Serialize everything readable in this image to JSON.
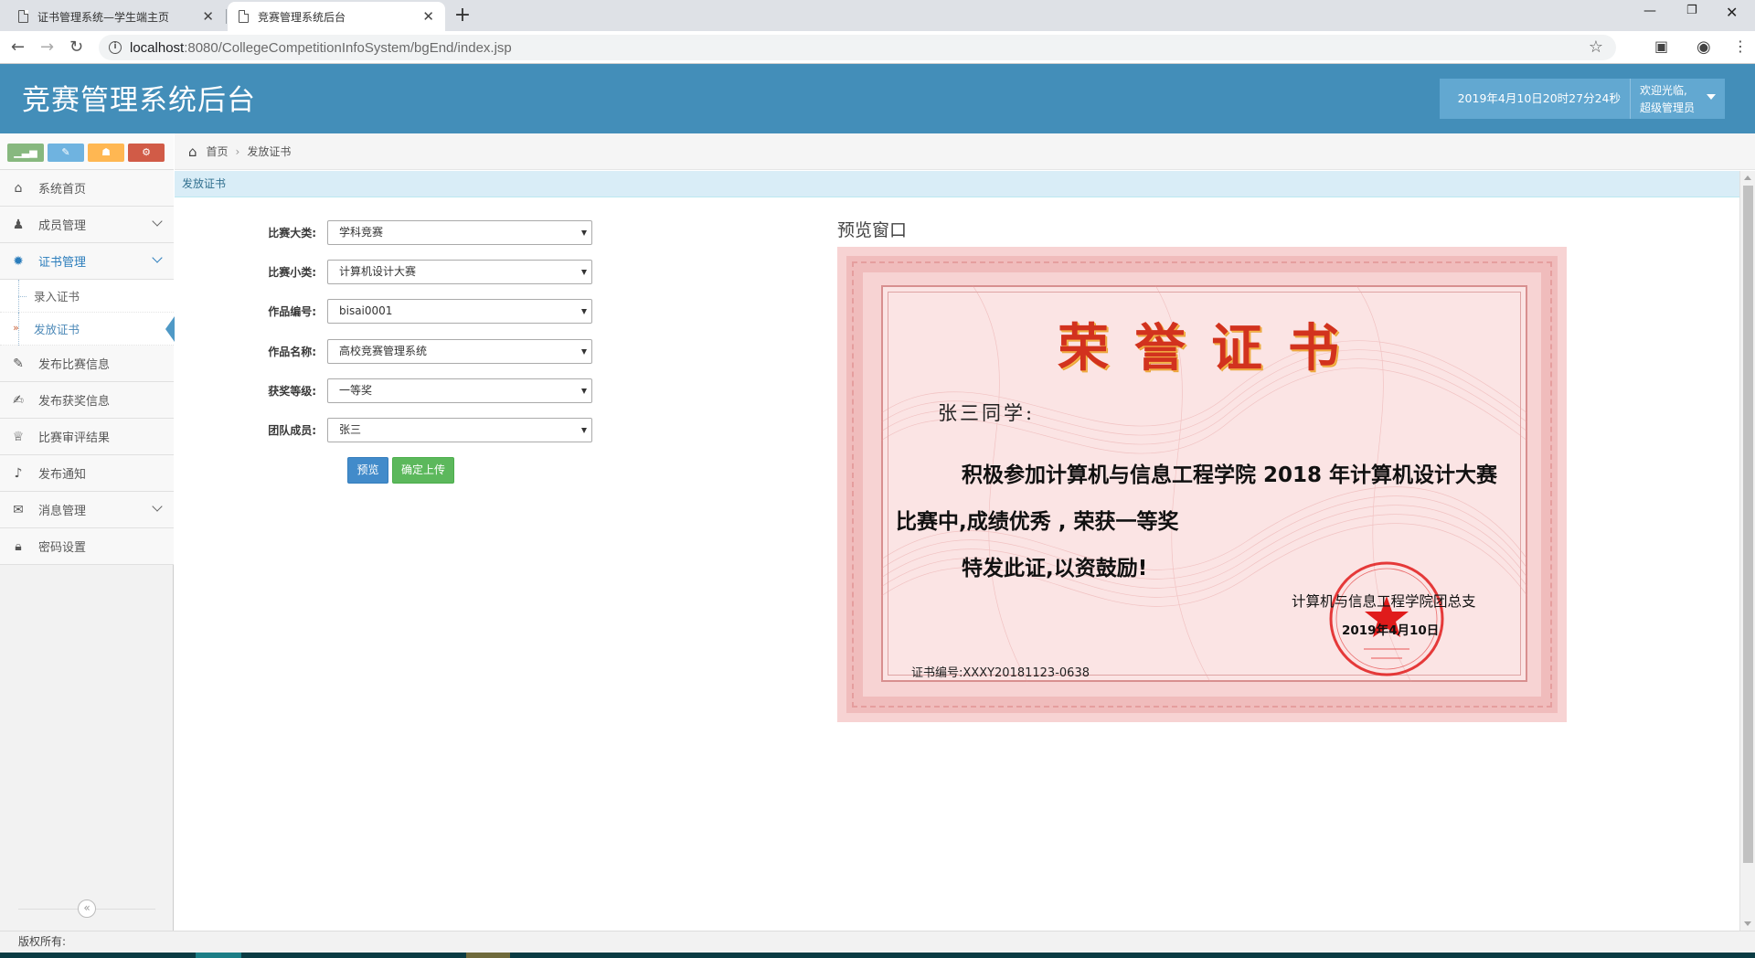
{
  "browser": {
    "tabs": [
      {
        "title": "证书管理系统—学生端主页",
        "active": false
      },
      {
        "title": "竞赛管理系统后台",
        "active": true
      }
    ],
    "url_host": "localhost",
    "url_rest": ":8080/CollegeCompetitionInfoSystem/bgEnd/index.jsp"
  },
  "header": {
    "title": "竞赛管理系统后台",
    "datetime": "2019年4月10日20时27分24秒",
    "welcome": "欢迎光临,",
    "user_role": "超级管理员"
  },
  "sidebar": {
    "items": [
      {
        "label": "系统首页",
        "icon": "home-icon"
      },
      {
        "label": "成员管理",
        "icon": "users-icon"
      },
      {
        "label": "证书管理",
        "icon": "gear-icon"
      },
      {
        "label": "发布比赛信息",
        "icon": "pencil-icon"
      },
      {
        "label": "发布获奖信息",
        "icon": "edit-icon"
      },
      {
        "label": "比赛审评结果",
        "icon": "trophy-icon"
      },
      {
        "label": "发布通知",
        "icon": "bell-icon"
      },
      {
        "label": "消息管理",
        "icon": "envelope-icon"
      },
      {
        "label": "密码设置",
        "icon": "lock-icon"
      }
    ],
    "sub_items": [
      {
        "label": "录入证书"
      },
      {
        "label": "发放证书"
      }
    ],
    "shortcut_colors": [
      "#87b87f",
      "#6fb3e0",
      "#ffb752",
      "#d15b47"
    ]
  },
  "breadcrumb": {
    "home": "首页",
    "current": "发放证书"
  },
  "panel": {
    "title": "发放证书"
  },
  "form": {
    "fields": [
      {
        "label": "比赛大类:",
        "value": "学科竞赛"
      },
      {
        "label": "比赛小类:",
        "value": "计算机设计大赛"
      },
      {
        "label": "作品编号:",
        "value": "bisai0001"
      },
      {
        "label": "作品名称:",
        "value": "高校竞赛管理系统"
      },
      {
        "label": "获奖等级:",
        "value": "一等奖"
      },
      {
        "label": "团队成员:",
        "value": "张三"
      }
    ],
    "preview_button": "预览",
    "upload_button": "确定上传"
  },
  "preview": {
    "title": "预览窗口",
    "certificate": {
      "heading": "荣誉证书",
      "recipient": "张三同学:",
      "line1": "积极参加计算机与信息工程学院 2018 年计算机设计大赛",
      "line2": "比赛中,成绩优秀 , 荣获一等奖",
      "line3": "特发此证,以资鼓励!",
      "org": "计算机与信息工程学院团总支",
      "date": "2019年4月10日",
      "cert_no": "证书编号:XXXY20181123-0638"
    }
  },
  "footer": {
    "text": "版权所有:"
  }
}
